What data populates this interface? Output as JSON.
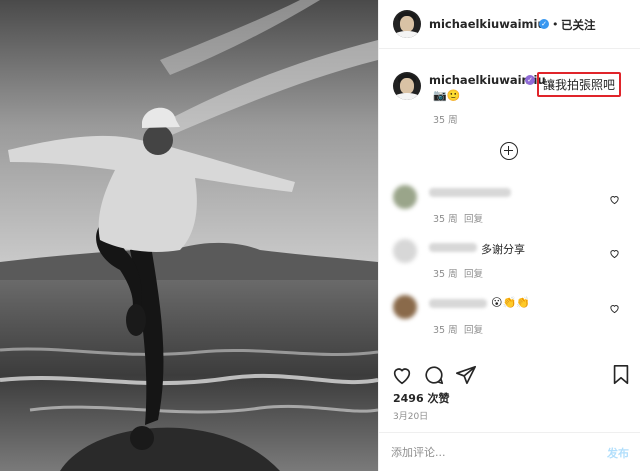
{
  "photo": {
    "alt": "black and white photo of person balancing on rocks by the sea"
  },
  "header": {
    "username": "michaelkiuwaimiu",
    "separator": "•",
    "follow_label": "已关注"
  },
  "caption": {
    "username": "michaelkiuwaimiu",
    "text": "讓我拍張照吧",
    "emoji": "📷🙂",
    "time": "35 周"
  },
  "comments": [
    {
      "text": "",
      "time": "35 周",
      "reply": "回复"
    },
    {
      "text": "多谢分享",
      "time": "35 周",
      "reply": "回复"
    },
    {
      "text": "😮👏👏",
      "time": "35 周",
      "reply": "回复"
    }
  ],
  "likes": "2496 次赞",
  "date": "3月20日",
  "composer": {
    "placeholder": "添加评论...",
    "post_label": "发布"
  },
  "icons": {
    "like": "heart-icon",
    "comment": "comment-icon",
    "share": "share-icon",
    "save": "bookmark-icon",
    "more": "plus-circle-icon"
  },
  "colors": {
    "verified": "#3897f0",
    "highlight_border": "#e0242a",
    "post_disabled": "#b2dffc"
  }
}
